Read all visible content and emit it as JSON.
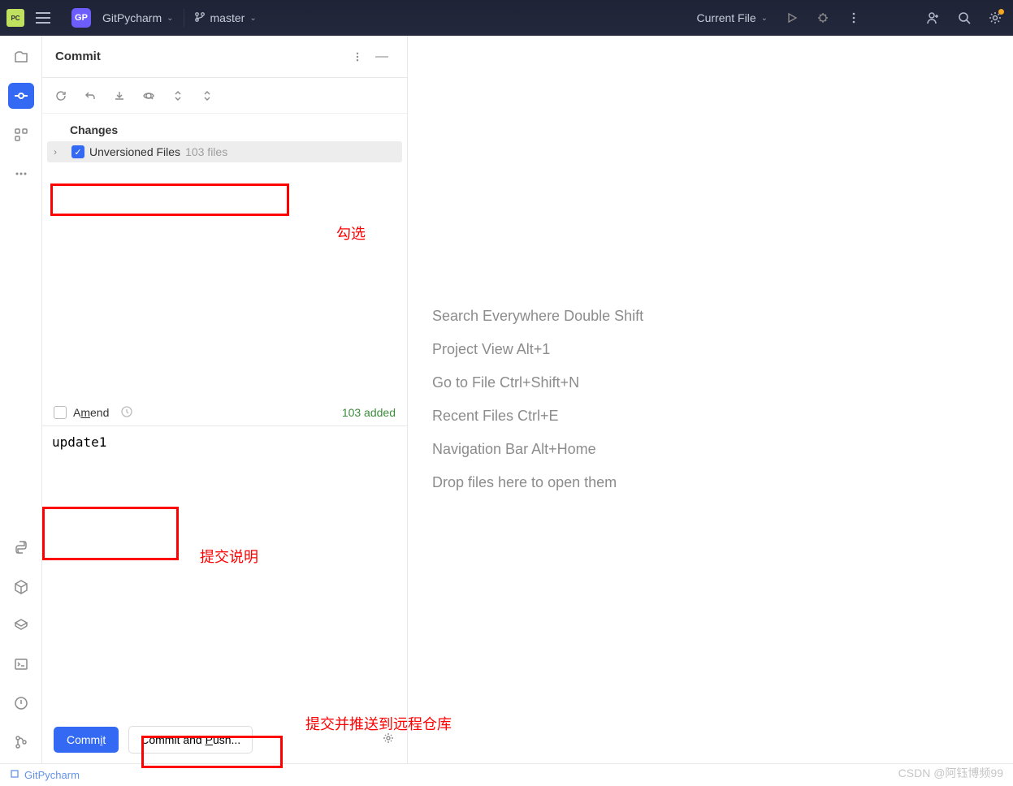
{
  "topbar": {
    "project_initials": "GP",
    "project_name": "GitPycharm",
    "branch_name": "master",
    "run_config": "Current File"
  },
  "commit_panel": {
    "title": "Commit",
    "changes_label": "Changes",
    "unversioned_label": "Unversioned Files",
    "unversioned_count": "103 files",
    "amend_label": "Amend",
    "added_text": "103 added",
    "message": "update1",
    "commit_btn": "Commit",
    "commit_push_btn": "Commit and Push..."
  },
  "editor_hints": [
    "Search Everywhere Double Shift",
    "Project View Alt+1",
    "Go to File Ctrl+Shift+N",
    "Recent Files Ctrl+E",
    "Navigation Bar Alt+Home",
    "Drop files here to open them"
  ],
  "statusbar": {
    "project": "GitPycharm"
  },
  "annotations": {
    "check": "勾选",
    "msg": "提交说明",
    "push": "提交并推送到远程仓库"
  },
  "watermark": "CSDN @阿钰博频99"
}
